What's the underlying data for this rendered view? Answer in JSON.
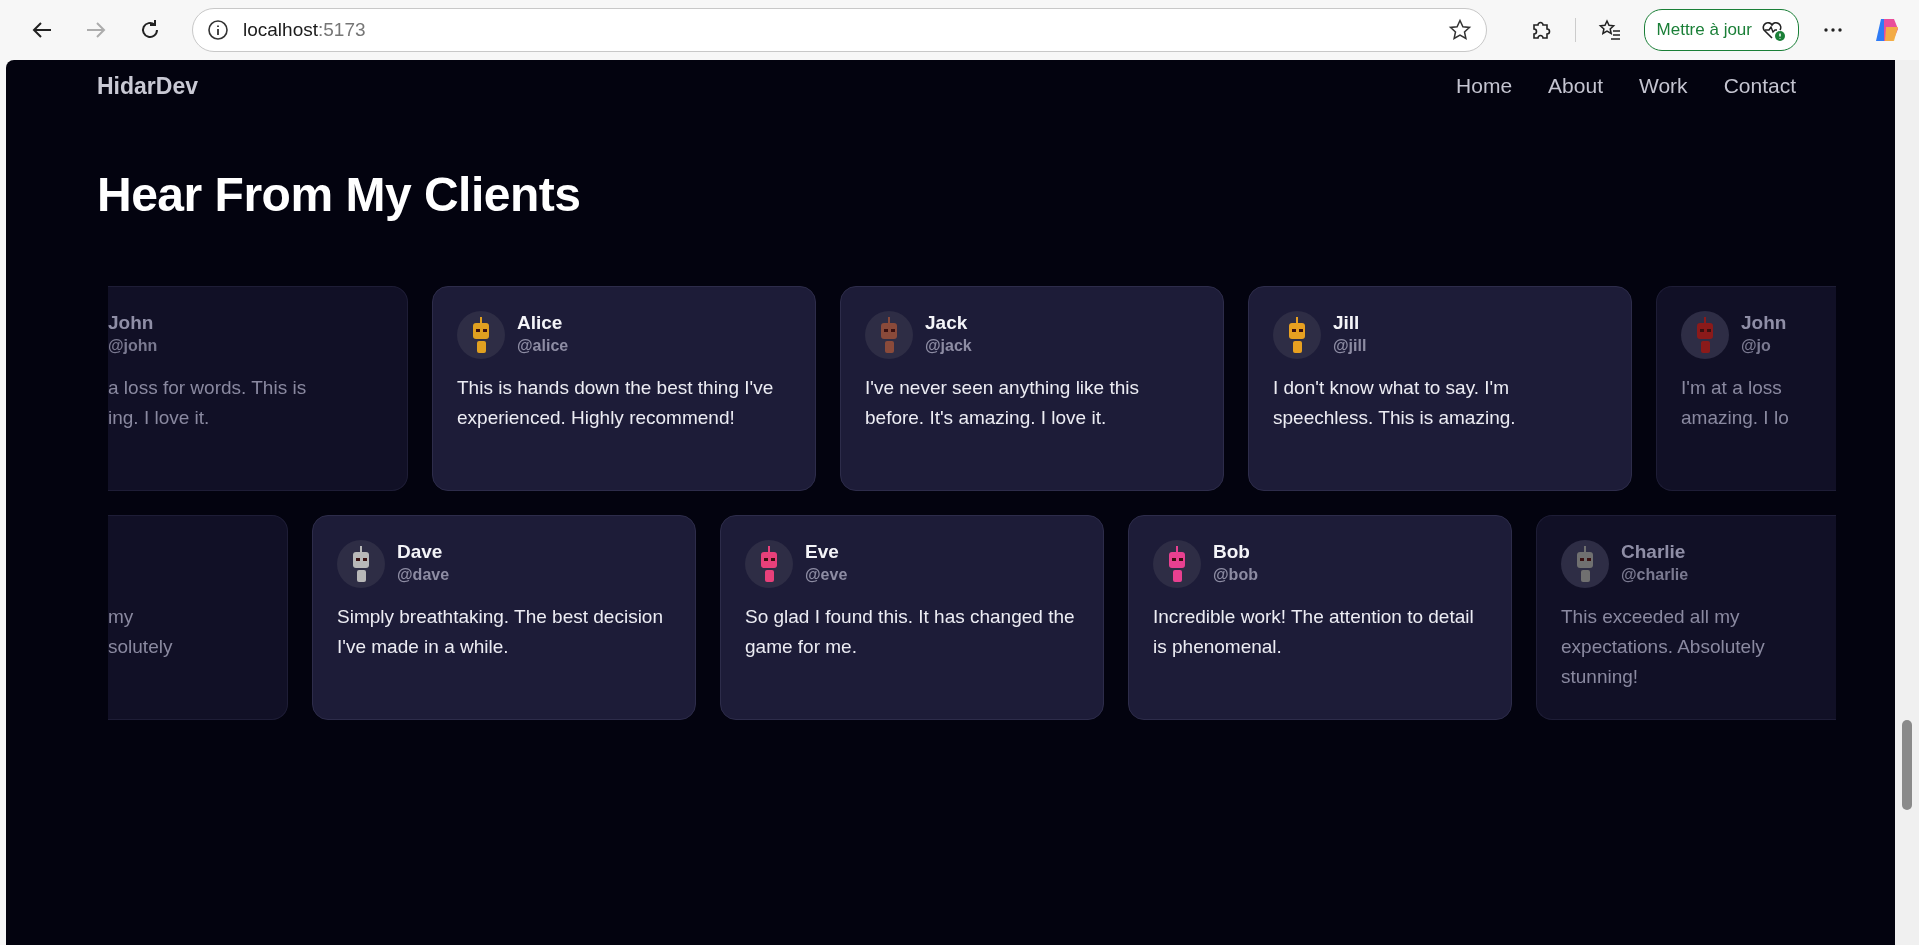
{
  "browser": {
    "back_disabled": false,
    "forward_disabled": true,
    "url_host": "localhost",
    "url_port": ":5173",
    "update_button": "Mettre à jour"
  },
  "site": {
    "brand": "HidarDev",
    "nav": [
      "Home",
      "About",
      "Work",
      "Contact"
    ]
  },
  "section": {
    "title": "Hear From My Clients"
  },
  "rows": [
    {
      "cards": [
        {
          "kind": "cut-left",
          "name": "John",
          "handle": "@john",
          "text": [
            "a loss for words. This is",
            "ing. I love it."
          ]
        },
        {
          "kind": "full",
          "name": "Alice",
          "handle": "@alice",
          "color": "#e0a020",
          "text": [
            "This is hands down the best thing I've experienced. Highly recommend!"
          ]
        },
        {
          "kind": "full",
          "name": "Jack",
          "handle": "@jack",
          "color": "#8a4a3a",
          "text": [
            "I've never seen anything like this before. It's amazing. I love it."
          ]
        },
        {
          "kind": "full",
          "name": "Jill",
          "handle": "@jill",
          "color": "#e8a020",
          "text": [
            "I don't know what to say. I'm speechless. This is amazing."
          ]
        },
        {
          "kind": "cut-right",
          "name": "John",
          "handle": "@jo",
          "color": "#8b1a1a",
          "text": [
            "I'm at a loss",
            "amazing. I lo"
          ]
        }
      ]
    },
    {
      "cards": [
        {
          "kind": "cut-left",
          "text": [
            "my",
            "solutely"
          ]
        },
        {
          "kind": "full",
          "name": "Dave",
          "handle": "@dave",
          "color": "#b8b8b8",
          "text": [
            "Simply breathtaking. The best decision I've made in a while."
          ]
        },
        {
          "kind": "full",
          "name": "Eve",
          "handle": "@eve",
          "color": "#e8407a",
          "text": [
            "So glad I found this. It has changed the game for me."
          ]
        },
        {
          "kind": "full",
          "name": "Bob",
          "handle": "@bob",
          "color": "#e84090",
          "text": [
            "Incredible work! The attention to detail is phenomenal."
          ]
        },
        {
          "kind": "cut-right",
          "name": "Charlie",
          "handle": "@charlie",
          "color": "#707070",
          "text": [
            "This exceeded all my",
            "expectations. Absolutely",
            "stunning!"
          ]
        }
      ]
    }
  ]
}
